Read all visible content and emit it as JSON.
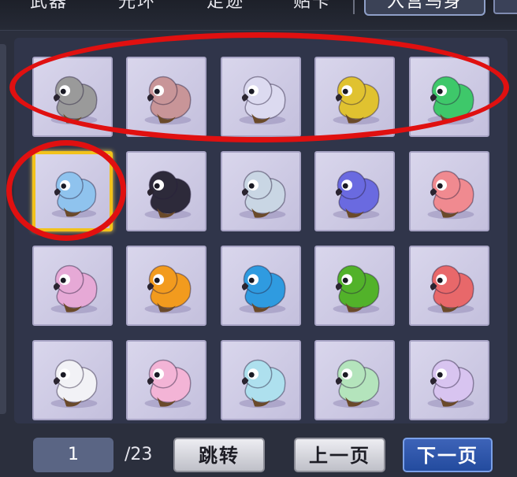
{
  "tabs": [
    {
      "label": "武器"
    },
    {
      "label": "光环"
    },
    {
      "label": "足迹"
    },
    {
      "label": "贴卡"
    },
    {
      "label": "入宫鸟身",
      "active": true
    }
  ],
  "grid": {
    "rows": [
      [
        {
          "name": "gray-parrot-pet",
          "color": "#9a9a9a"
        },
        {
          "name": "pink-parrot-pet",
          "color": "#c89598"
        },
        {
          "name": "white-parrot-pet",
          "color": "#dcdaf0"
        },
        {
          "name": "yellow-parrot-pet",
          "color": "#e0c230"
        },
        {
          "name": "green-parrot-pet",
          "color": "#3ec86a"
        }
      ],
      [
        {
          "name": "blue-parrot-pet",
          "color": "#8fc3ee",
          "selected": true
        },
        {
          "name": "dark-owl-pet",
          "color": "#2d2a3a"
        },
        {
          "name": "silver-owl-pet",
          "color": "#c9d6e4"
        },
        {
          "name": "violet-owl-pet",
          "color": "#6a6ae0"
        },
        {
          "name": "coral-owl-pet",
          "color": "#f08a90"
        }
      ],
      [
        {
          "name": "pink-fledgling-pet",
          "color": "#e6a9d6"
        },
        {
          "name": "orange-fledgling-pet",
          "color": "#f29b1e"
        },
        {
          "name": "azure-fledgling-pet",
          "color": "#2f9be0"
        },
        {
          "name": "green-fledgling-pet",
          "color": "#52b22a"
        },
        {
          "name": "red-hat-fledgling-pet",
          "color": "#e8686a"
        }
      ],
      [
        {
          "name": "white-crow-pet",
          "color": "#f2f2f6"
        },
        {
          "name": "pink-crow-pet",
          "color": "#f3b4d6"
        },
        {
          "name": "cyan-crow-pet",
          "color": "#aee0ee"
        },
        {
          "name": "mint-crow-pet",
          "color": "#b4e4bc"
        },
        {
          "name": "lilac-crow-pet",
          "color": "#d8c4f0"
        }
      ]
    ]
  },
  "pager": {
    "current_page": "1",
    "total_pages": "/23",
    "jump_label": "跳转",
    "prev_label": "上一页",
    "next_label": "下一页"
  },
  "colors": {
    "selection_border": "#f2c21b",
    "annotation_ring": "#e01010"
  }
}
